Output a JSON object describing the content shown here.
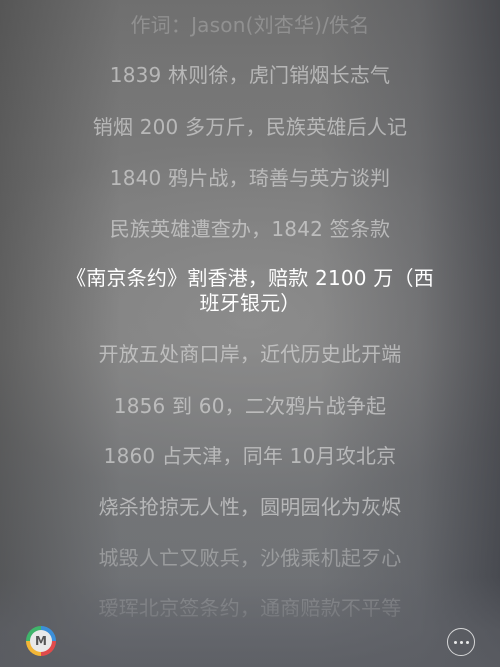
{
  "lyrics": {
    "lines": [
      "作词：Jason(刘杏华)/佚名",
      "1839 林则徐，虎门销烟长志气",
      "销烟 200 多万斤，民族英雄后人记",
      "1840 鸦片战，琦善与英方谈判",
      "民族英雄遭查办，1842 签条款",
      "《南京条约》割香港，赔款 2100 万（西班牙银元）",
      "开放五处商口岸，近代历史此开端",
      "1856 到 60，二次鸦片战争起",
      "1860 占天津，同年 10月攻北京",
      "烧杀抢掠无人性，圆明园化为灰烬",
      "城毁人亡又败兵，沙俄乘机起歹心",
      "瑷珲北京签条约，通商赔款不平等"
    ],
    "active_index": 5
  },
  "controls": {
    "app_logo_letter": "M",
    "more_icon": "more-horizontal-icon"
  }
}
